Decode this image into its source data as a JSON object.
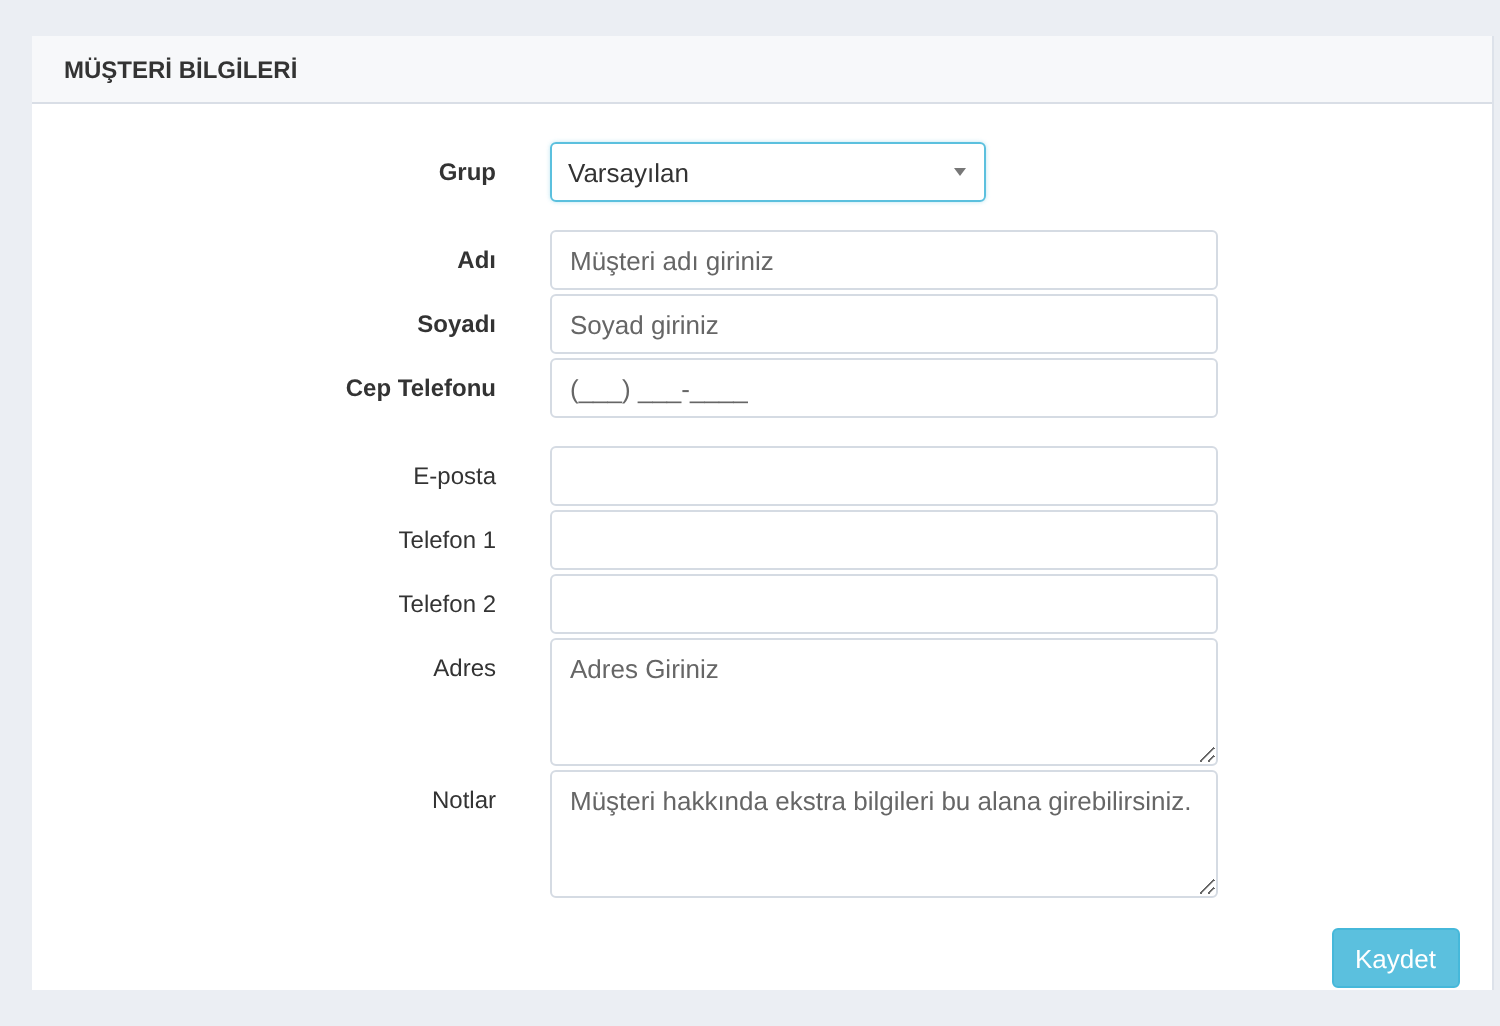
{
  "panel": {
    "title": "MÜŞTERİ BİLGİLERİ"
  },
  "sections": [
    {
      "fields": [
        {
          "label": "Grup",
          "kind": "select",
          "required": true,
          "value": "Varsayılan",
          "focused": true
        }
      ]
    },
    {
      "fields": [
        {
          "label": "Adı",
          "kind": "text",
          "required": true,
          "placeholder": "Müşteri adı giriniz",
          "focused": false
        },
        {
          "label": "Soyadı",
          "kind": "text",
          "required": true,
          "placeholder": "Soyad giriniz",
          "focused": false
        },
        {
          "label": "Cep Telefonu",
          "kind": "text",
          "required": true,
          "placeholder": "(___) ___-____",
          "focused": false
        }
      ]
    },
    {
      "fields": [
        {
          "label": "E-posta",
          "kind": "text",
          "required": false,
          "focused": false
        },
        {
          "label": "Telefon 1",
          "kind": "text",
          "required": false,
          "focused": false
        },
        {
          "label": "Telefon 2",
          "kind": "text",
          "required": false,
          "focused": false
        },
        {
          "label": "Adres",
          "kind": "textarea",
          "required": false,
          "placeholder": "Adres Giriniz",
          "focused": false
        },
        {
          "label": "Notlar",
          "kind": "textarea",
          "required": false,
          "placeholder": "Müşteri hakkında ekstra bilgileri bu alana girebilirsiniz.",
          "focused": false
        }
      ]
    }
  ],
  "submit": {
    "label": "Kaydet"
  }
}
